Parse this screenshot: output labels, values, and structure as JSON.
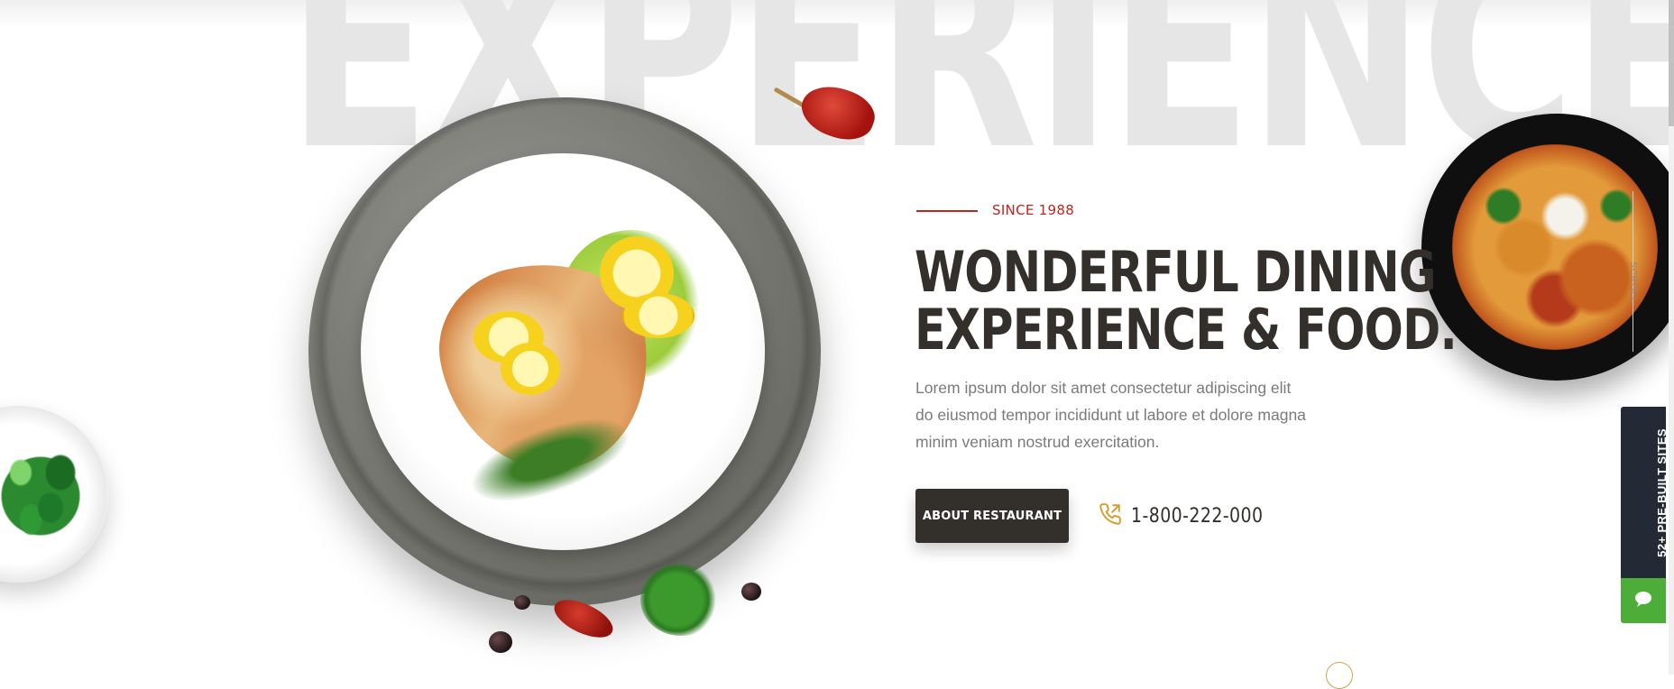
{
  "hero": {
    "background_word": "EXPERIENCE",
    "since_label": "SINCE 1988",
    "headline_line1": "WONDERFUL DINING",
    "headline_line2": "EXPERIENCE & FOOD.",
    "description": "Lorem ipsum dolor sit amet consectetur adipiscing elit do eiusmod tempor incididunt ut labore et dolore magna minim veniam nostrud exercitation.",
    "about_button_label": "ABOUT RESTAURANT",
    "phone_number": "1-800-222-000",
    "phone_icon": "phone-call-icon"
  },
  "sidebar": {
    "rail_label": "SCROLL",
    "prebuilt_label": "52+ PRE-BUILT SITES",
    "chat_icon": "chat-bubble-icon"
  },
  "colors": {
    "accent_red": "#c0241d",
    "dark": "#33302c",
    "phone_icon_gold": "#d99b2b",
    "sidebar_dark": "#232a35",
    "chat_green": "#4cae38"
  }
}
